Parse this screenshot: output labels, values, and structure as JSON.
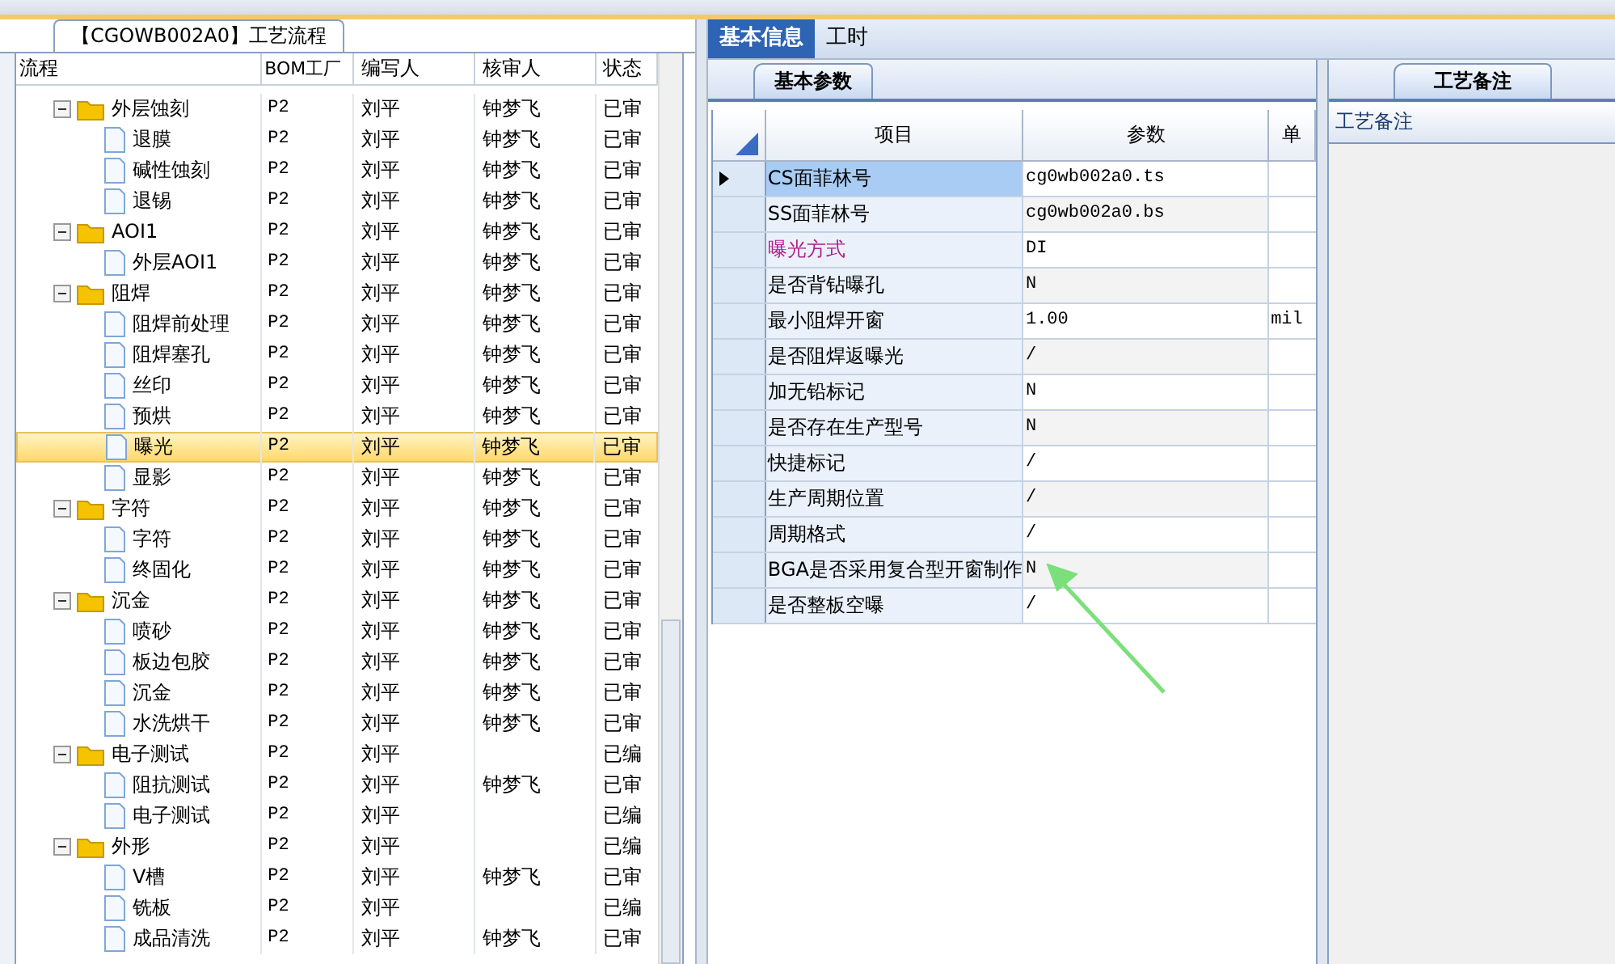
{
  "flow_panel": {
    "tab": "【CGOWB002A0】工艺流程",
    "columns": [
      "流程",
      "BOM工厂",
      "编写人",
      "核审人",
      "状态"
    ],
    "rows": [
      {
        "name": "外层蚀刻",
        "bom": "P2",
        "writer": "刘平",
        "reviewer": "钟梦飞",
        "status": "已审",
        "expanded": true,
        "selected": false,
        "children": [
          {
            "name": "退膜",
            "bom": "P2",
            "writer": "刘平",
            "reviewer": "钟梦飞",
            "status": "已审",
            "selected": false
          },
          {
            "name": "碱性蚀刻",
            "bom": "P2",
            "writer": "刘平",
            "reviewer": "钟梦飞",
            "status": "已审",
            "selected": false
          },
          {
            "name": "退锡",
            "bom": "P2",
            "writer": "刘平",
            "reviewer": "钟梦飞",
            "status": "已审",
            "selected": false
          }
        ]
      },
      {
        "name": "AOI1",
        "bom": "P2",
        "writer": "刘平",
        "reviewer": "钟梦飞",
        "status": "已审",
        "expanded": true,
        "selected": false,
        "children": [
          {
            "name": "外层AOI1",
            "bom": "P2",
            "writer": "刘平",
            "reviewer": "钟梦飞",
            "status": "已审",
            "selected": false
          }
        ]
      },
      {
        "name": "阻焊",
        "bom": "P2",
        "writer": "刘平",
        "reviewer": "钟梦飞",
        "status": "已审",
        "expanded": true,
        "selected": false,
        "children": [
          {
            "name": "阻焊前处理",
            "bom": "P2",
            "writer": "刘平",
            "reviewer": "钟梦飞",
            "status": "已审",
            "selected": false
          },
          {
            "name": "阻焊塞孔",
            "bom": "P2",
            "writer": "刘平",
            "reviewer": "钟梦飞",
            "status": "已审",
            "selected": false
          },
          {
            "name": "丝印",
            "bom": "P2",
            "writer": "刘平",
            "reviewer": "钟梦飞",
            "status": "已审",
            "selected": false
          },
          {
            "name": "预烘",
            "bom": "P2",
            "writer": "刘平",
            "reviewer": "钟梦飞",
            "status": "已审",
            "selected": false
          },
          {
            "name": "曝光",
            "bom": "P2",
            "writer": "刘平",
            "reviewer": "钟梦飞",
            "status": "已审",
            "selected": true
          },
          {
            "name": "显影",
            "bom": "P2",
            "writer": "刘平",
            "reviewer": "钟梦飞",
            "status": "已审",
            "selected": false
          }
        ]
      },
      {
        "name": "字符",
        "bom": "P2",
        "writer": "刘平",
        "reviewer": "钟梦飞",
        "status": "已审",
        "expanded": true,
        "selected": false,
        "children": [
          {
            "name": "字符",
            "bom": "P2",
            "writer": "刘平",
            "reviewer": "钟梦飞",
            "status": "已审",
            "selected": false
          },
          {
            "name": "终固化",
            "bom": "P2",
            "writer": "刘平",
            "reviewer": "钟梦飞",
            "status": "已审",
            "selected": false
          }
        ]
      },
      {
        "name": "沉金",
        "bom": "P2",
        "writer": "刘平",
        "reviewer": "钟梦飞",
        "status": "已审",
        "expanded": true,
        "selected": false,
        "children": [
          {
            "name": "喷砂",
            "bom": "P2",
            "writer": "刘平",
            "reviewer": "钟梦飞",
            "status": "已审",
            "selected": false
          },
          {
            "name": "板边包胶",
            "bom": "P2",
            "writer": "刘平",
            "reviewer": "钟梦飞",
            "status": "已审",
            "selected": false
          },
          {
            "name": "沉金",
            "bom": "P2",
            "writer": "刘平",
            "reviewer": "钟梦飞",
            "status": "已审",
            "selected": false
          },
          {
            "name": "水洗烘干",
            "bom": "P2",
            "writer": "刘平",
            "reviewer": "钟梦飞",
            "status": "已审",
            "selected": false
          }
        ]
      },
      {
        "name": "电子测试",
        "bom": "P2",
        "writer": "刘平",
        "status": "已编",
        "expanded": true,
        "selected": false,
        "children": [
          {
            "name": "阻抗测试",
            "bom": "P2",
            "writer": "刘平",
            "reviewer": "钟梦飞",
            "status": "已审",
            "selected": false
          },
          {
            "name": "电子测试",
            "bom": "P2",
            "writer": "刘平",
            "status": "已编",
            "selected": false
          }
        ]
      },
      {
        "name": "外形",
        "bom": "P2",
        "writer": "刘平",
        "status": "已编",
        "expanded": true,
        "selected": false,
        "children": [
          {
            "name": "V槽",
            "bom": "P2",
            "writer": "刘平",
            "reviewer": "钟梦飞",
            "status": "已审",
            "selected": false
          },
          {
            "name": "铣板",
            "bom": "P2",
            "writer": "刘平",
            "status": "已编",
            "selected": false
          },
          {
            "name": "成品清洗",
            "bom": "P2",
            "writer": "刘平",
            "reviewer": "钟梦飞",
            "status": "已审",
            "selected": false
          }
        ]
      }
    ]
  },
  "tabs": [
    {
      "label": "基本信息",
      "selected": true
    },
    {
      "label": "工时",
      "selected": false
    }
  ],
  "params_panel": {
    "tab": "基本参数",
    "columns": [
      "项目",
      "参数",
      "单"
    ],
    "rows": [
      {
        "item": "CS面菲林号",
        "value": "cg0wb002a0.ts",
        "kind": "normal",
        "current": true
      },
      {
        "item": "SS面菲林号",
        "value": "cg0wb002a0.bs",
        "kind": "normal",
        "current": false
      },
      {
        "item": "曝光方式",
        "value": "DI",
        "kind": "emphasized",
        "current": false
      },
      {
        "item": "是否背钻曝孔",
        "value": "N",
        "kind": "normal",
        "current": false
      },
      {
        "item": "最小阻焊开窗",
        "value": "1.00",
        "unit": "mil",
        "kind": "normal",
        "current": false
      },
      {
        "item": "是否阻焊返曝光",
        "value": "/",
        "kind": "normal",
        "current": false
      },
      {
        "item": "加无铅标记",
        "value": "N",
        "kind": "normal",
        "current": false
      },
      {
        "item": "是否存在生产型号",
        "value": "N",
        "kind": "normal",
        "current": false
      },
      {
        "item": "快捷标记",
        "value": "/",
        "kind": "normal",
        "current": false
      },
      {
        "item": "生产周期位置",
        "value": "/",
        "kind": "normal",
        "current": false
      },
      {
        "item": "周期格式",
        "value": "/",
        "kind": "normal",
        "current": false
      },
      {
        "item": "BGA是否采用复合型开窗制作",
        "value": "N",
        "kind": "normal",
        "current": false
      },
      {
        "item": "是否整板空曝",
        "value": "/",
        "kind": "normal",
        "current": false
      }
    ]
  },
  "notes_panel": {
    "tab": "工艺备注",
    "header": "工艺备注"
  }
}
